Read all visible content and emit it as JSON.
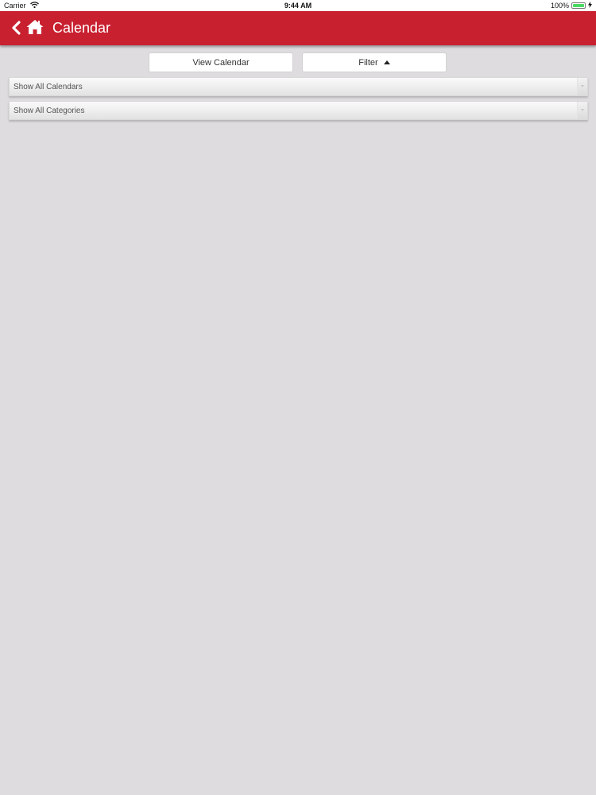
{
  "status_bar": {
    "carrier": "Carrier",
    "time": "9:44 AM",
    "battery_percent": "100%",
    "battery_level": 1.0
  },
  "header": {
    "title": "Calendar",
    "color": "#c8202f",
    "back_icon": "chevron-left-icon",
    "home_icon": "home-icon"
  },
  "toggle": {
    "view_calendar_label": "View Calendar",
    "filter_label": "Filter"
  },
  "filters": {
    "calendars_select": "Show All Calendars",
    "categories_select": "Show All Categories"
  }
}
